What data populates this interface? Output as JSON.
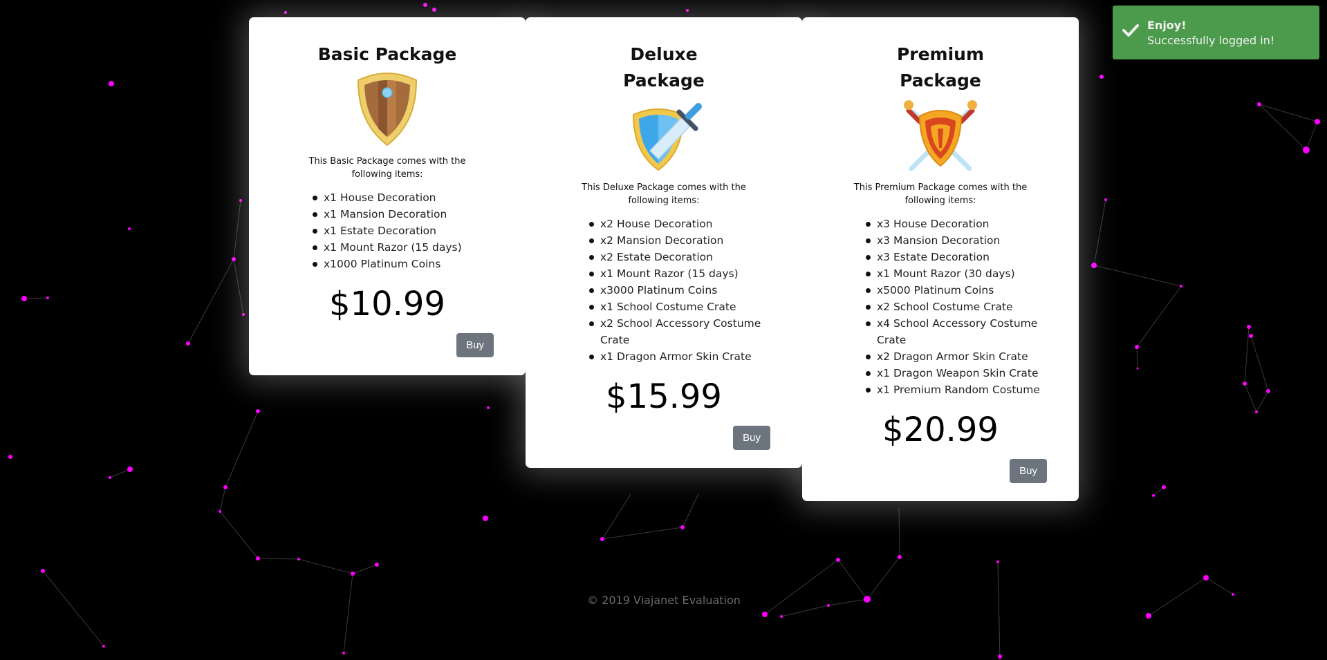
{
  "packages": [
    {
      "title": "Basic Package",
      "icon": "wooden-shield-icon",
      "description": "This Basic Package comes with the following items:",
      "items": [
        "x1 House Decoration",
        "x1 Mansion Decoration",
        "x1 Estate Decoration",
        "x1 Mount Razor (15 days)",
        "x1000 Platinum Coins"
      ],
      "price": "$10.99",
      "buy_label": "Buy"
    },
    {
      "title": "Deluxe Package",
      "icon": "shield-sword-icon",
      "description": "This Deluxe Package comes with the following items:",
      "items": [
        "x2 House Decoration",
        "x2 Mansion Decoration",
        "x2 Estate Decoration",
        "x1 Mount Razor (15 days)",
        "x3000 Platinum Coins",
        "x1 School Costume Crate",
        "x2 School Accessory Costume Crate",
        "x1 Dragon Armor Skin Crate"
      ],
      "price": "$15.99",
      "buy_label": "Buy"
    },
    {
      "title": "Premium Package",
      "icon": "crossed-swords-shield-icon",
      "description": "This Premium Package comes with the following items:",
      "items": [
        "x3 House Decoration",
        "x3 Mansion Decoration",
        "x3 Estate Decoration",
        "x1 Mount Razor (30 days)",
        "x5000 Platinum Coins",
        "x2 School Costume Crate",
        "x4 School Accessory Costume Crate",
        "x2 Dragon Armor Skin Crate",
        "x1 Dragon Weapon Skin Crate",
        "x1 Premium Random Costume"
      ],
      "price": "$20.99",
      "buy_label": "Buy"
    }
  ],
  "toast": {
    "title": "Enjoy!",
    "message": "Successfully logged in!",
    "icon": "check-icon",
    "color": "#51a351"
  },
  "footer": {
    "text": "© 2019 Viajanet Evaluation"
  },
  "colors": {
    "background": "#000000",
    "particle": "#ff00ff",
    "buy_button": "#6c757d"
  }
}
